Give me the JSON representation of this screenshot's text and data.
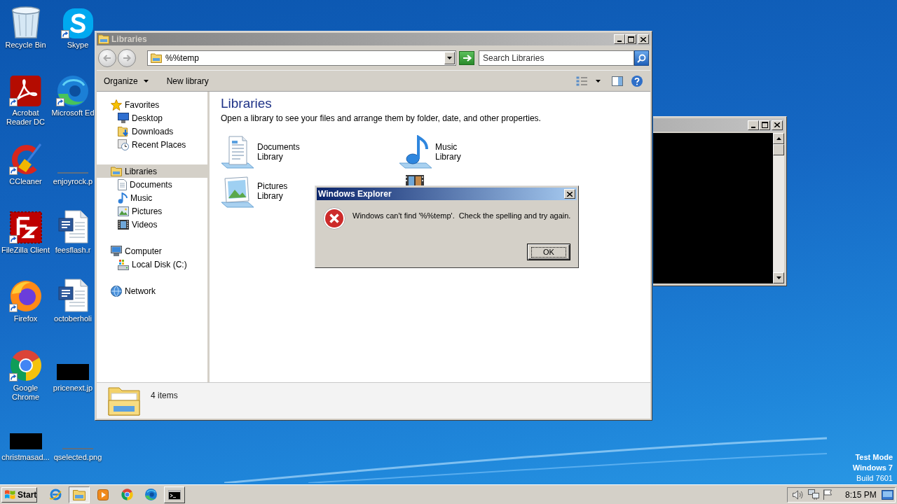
{
  "desktop": {
    "icons": [
      {
        "label": "Recycle Bin",
        "kind": "recycle-bin",
        "shortcut": false
      },
      {
        "label": "Skype",
        "kind": "skype",
        "shortcut": true
      },
      {
        "label": "Acrobat Reader DC",
        "kind": "acrobat",
        "shortcut": true
      },
      {
        "label": "Microsoft Ed",
        "kind": "edge",
        "shortcut": true
      },
      {
        "label": "CCleaner",
        "kind": "ccleaner",
        "shortcut": true
      },
      {
        "label": "enjoyrock.p",
        "kind": "strip-image",
        "shortcut": false
      },
      {
        "label": "FileZilla Client",
        "kind": "filezilla",
        "shortcut": true
      },
      {
        "label": "feesflash.r",
        "kind": "word-doc",
        "shortcut": false
      },
      {
        "label": "Firefox",
        "kind": "firefox",
        "shortcut": true
      },
      {
        "label": "octoberholi",
        "kind": "word-doc",
        "shortcut": false
      },
      {
        "label": "Google Chrome",
        "kind": "chrome",
        "shortcut": true
      },
      {
        "label": "pricenext.jp",
        "kind": "dark-image",
        "shortcut": false
      },
      {
        "label": "christmasad...",
        "kind": "dark-image",
        "shortcut": false
      },
      {
        "label": "qselected.png",
        "kind": "strip-image",
        "shortcut": false
      }
    ]
  },
  "explorer": {
    "title": "Libraries",
    "active": false,
    "address": {
      "value": "%%temp"
    },
    "search": {
      "placeholder": "Search Libraries"
    },
    "toolbar": [
      {
        "label": "Organize",
        "dropdown": true
      },
      {
        "label": "New library",
        "dropdown": false
      }
    ],
    "nav": [
      {
        "label": "Favorites",
        "kind": "favorites",
        "selected": false,
        "children": [
          {
            "label": "Desktop",
            "kind": "desktop",
            "selected": false
          },
          {
            "label": "Downloads",
            "kind": "downloads",
            "selected": false
          },
          {
            "label": "Recent Places",
            "kind": "recent-places",
            "selected": false
          }
        ]
      },
      {
        "label": "Libraries",
        "kind": "libraries",
        "selected": true,
        "children": [
          {
            "label": "Documents",
            "kind": "documents",
            "selected": false
          },
          {
            "label": "Music",
            "kind": "music",
            "selected": false
          },
          {
            "label": "Pictures",
            "kind": "pictures",
            "selected": false
          },
          {
            "label": "Videos",
            "kind": "videos",
            "selected": false
          }
        ]
      },
      {
        "label": "Computer",
        "kind": "computer",
        "selected": false,
        "children": [
          {
            "label": "Local Disk (C:)",
            "kind": "local-disk",
            "selected": false
          }
        ]
      },
      {
        "label": "Network",
        "kind": "network",
        "selected": false
      }
    ],
    "heading": "Libraries",
    "description": "Open a library to see your files and arrange them by folder, date, and other properties.",
    "libraries": [
      {
        "kind": "documents",
        "name": "Documents",
        "type": "Library"
      },
      {
        "kind": "music",
        "name": "Music",
        "type": "Library"
      },
      {
        "kind": "pictures",
        "name": "Pictures",
        "type": "Library"
      },
      {
        "kind": "videos"
      }
    ],
    "item_count": "4 items"
  },
  "console_window": {
    "active": false
  },
  "dialog": {
    "title": "Windows Explorer",
    "active": true,
    "message": "Windows can't find '%%temp'.  Check the spelling and try again.",
    "buttons": [
      {
        "label": "OK",
        "focused": true
      }
    ]
  },
  "system_info": {
    "mode": "Test Mode",
    "os": "Windows 7",
    "build": "Build 7601"
  },
  "taskbar": {
    "start": "Start",
    "apps": [
      {
        "kind": "internet-explorer",
        "running": false,
        "selected": false
      },
      {
        "kind": "explorer",
        "running": true,
        "selected": true
      },
      {
        "kind": "media-player",
        "running": false,
        "selected": false
      },
      {
        "kind": "chrome",
        "running": false,
        "selected": false
      },
      {
        "kind": "edge",
        "running": false,
        "selected": false
      },
      {
        "kind": "command-prompt",
        "running": true,
        "selected": false
      }
    ],
    "clock": "8:15 PM"
  }
}
